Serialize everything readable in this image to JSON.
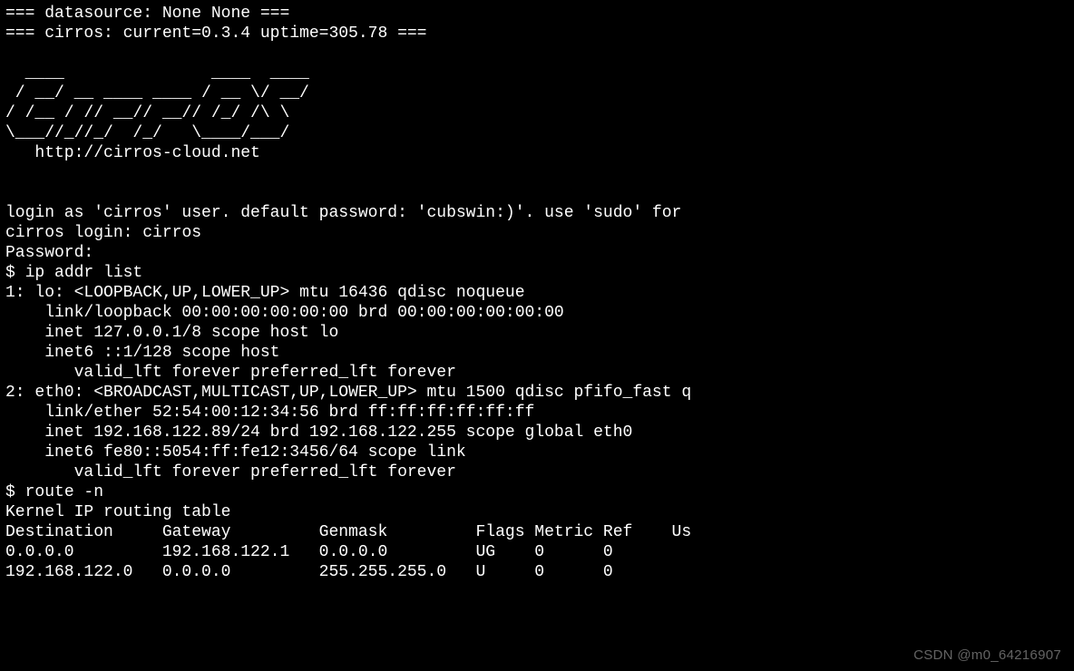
{
  "boot": {
    "datasource_line": "=== datasource: None None ===",
    "cirros_line": "=== cirros: current=0.3.4 uptime=305.78 ==="
  },
  "ascii": {
    "l1": "  ____               ____  ____",
    "l2": " / __/ __ ____ ____ / __ \\/ __/",
    "l3": "/ /__ / // __// __// /_/ /\\ \\ ",
    "l4": "\\___//_//_/  /_/   \\____/___/ ",
    "url": "   http://cirros-cloud.net"
  },
  "login": {
    "hint": "login as 'cirros' user. default password: 'cubswin:)'. use 'sudo' for",
    "prompt": "cirros login: ",
    "username": "cirros",
    "password_prompt": "Password:"
  },
  "cmd1": {
    "prompt": "$ ",
    "command": "ip addr list"
  },
  "ipaddr": {
    "lo_header": "1: lo: <LOOPBACK,UP,LOWER_UP> mtu 16436 qdisc noqueue ",
    "lo_link": "    link/loopback 00:00:00:00:00:00 brd 00:00:00:00:00:00",
    "lo_inet": "    inet 127.0.0.1/8 scope host lo",
    "lo_inet6": "    inet6 ::1/128 scope host ",
    "lo_valid": "       valid_lft forever preferred_lft forever",
    "eth_header": "2: eth0: <BROADCAST,MULTICAST,UP,LOWER_UP> mtu 1500 qdisc pfifo_fast q",
    "eth_link": "    link/ether 52:54:00:12:34:56 brd ff:ff:ff:ff:ff:ff",
    "eth_inet": "    inet 192.168.122.89/24 brd 192.168.122.255 scope global eth0",
    "eth_inet6": "    inet6 fe80::5054:ff:fe12:3456/64 scope link ",
    "eth_valid": "       valid_lft forever preferred_lft forever"
  },
  "cmd2": {
    "prompt": "$ ",
    "command": "route -n"
  },
  "route": {
    "title": "Kernel IP routing table",
    "header": "Destination     Gateway         Genmask         Flags Metric Ref    Us",
    "rows": [
      "0.0.0.0         192.168.122.1   0.0.0.0         UG    0      0        ",
      "192.168.122.0   0.0.0.0         255.255.255.0   U     0      0        "
    ]
  },
  "watermark": "CSDN @m0_64216907"
}
